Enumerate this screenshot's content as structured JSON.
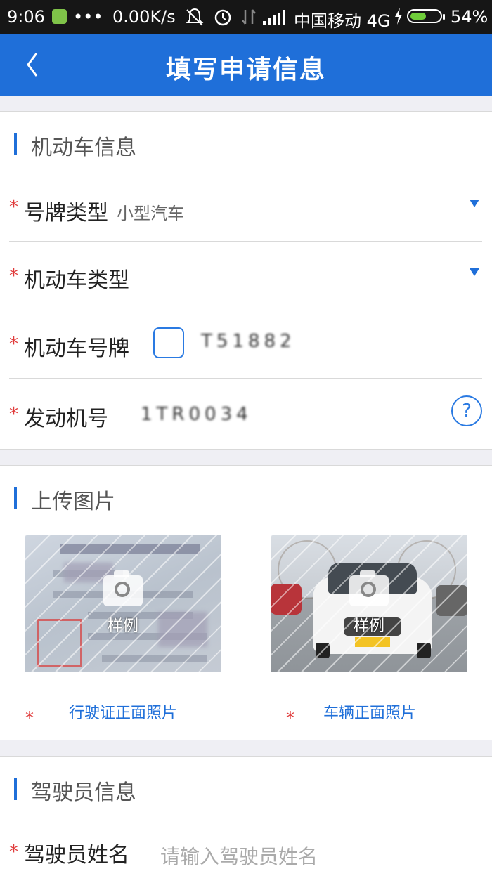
{
  "status_bar": {
    "time": "9:06",
    "dots": "•••",
    "net_speed": "0.00K/s",
    "carrier": "中国移动 4G",
    "battery": "54%",
    "battery_level": 0.54,
    "icons": [
      "app-notification-icon",
      "mute-icon",
      "alarm-icon",
      "data-arrows-icon",
      "signal-icon",
      "charging-icon",
      "battery-icon"
    ]
  },
  "header": {
    "title": "填写申请信息",
    "back_icon": "chevron-left-icon"
  },
  "vehicle_section": {
    "title": "机动车信息",
    "plate_type": {
      "required": "*",
      "label": "号牌类型",
      "value": "小型汽车"
    },
    "vehicle_type": {
      "required": "*",
      "label": "机动车类型",
      "value": ""
    },
    "plate_number": {
      "required": "*",
      "label": "机动车号牌",
      "prefix": "",
      "value": "T51882"
    },
    "engine_number": {
      "required": "*",
      "label": "发动机号",
      "value": "1TR0034",
      "help": "?"
    }
  },
  "upload_section": {
    "title": "上传图片",
    "items": [
      {
        "required": "*",
        "label": "行驶证正面照片",
        "sample": "样例"
      },
      {
        "required": "*",
        "label": "车辆正面照片",
        "sample": "样例"
      }
    ]
  },
  "driver_section": {
    "title": "驾驶员信息",
    "driver_name": {
      "required": "*",
      "label": "驾驶员姓名",
      "placeholder": "请输入驾驶员姓名"
    }
  },
  "colors": {
    "accent": "#1f6fd9",
    "required": "#e03c3c",
    "status_bar": "#161616"
  }
}
